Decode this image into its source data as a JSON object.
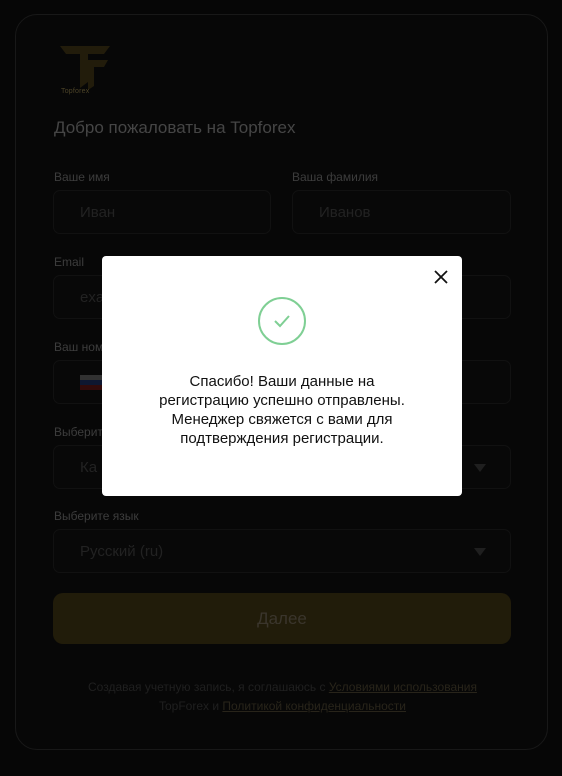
{
  "brand": {
    "name": "Topforex",
    "accent": "#c9a640"
  },
  "form": {
    "title": "Добро пожаловать на Topforex",
    "first_name": {
      "label": "Ваше имя",
      "placeholder": "Иван"
    },
    "last_name": {
      "label": "Ваша фамилия",
      "placeholder": "Иванов"
    },
    "email": {
      "label": "Email",
      "placeholder": "exa"
    },
    "phone": {
      "label": "Ваш ном"
    },
    "country": {
      "label": "Выберит",
      "value": "Ка"
    },
    "language": {
      "label": "Выберите язык",
      "value": "Русский (ru)"
    },
    "submit_label": "Далее"
  },
  "terms": {
    "prefix": "Создавая учетную запись, я соглашаюсь с ",
    "link1": "Условиями использования",
    "middle": " TopForex и ",
    "link2": "Политикой конфиденциальности"
  },
  "modal": {
    "message": "Спасибо! Ваши данные на\nрегистрацию успешно отправлены.\nМенеджер свяжется с вами для\nподтверждения регистрации.",
    "success_color": "#7fcf94"
  }
}
